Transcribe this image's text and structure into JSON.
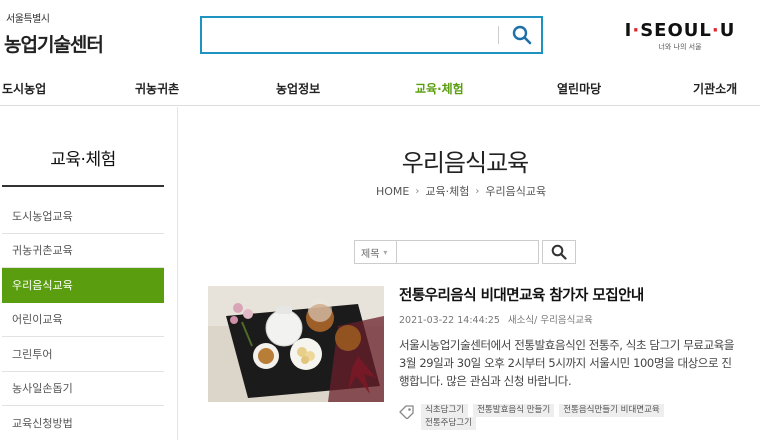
{
  "header": {
    "logo_small": "서울특별시",
    "logo_main": "농업기술센터",
    "search": {
      "value": "",
      "placeholder": ""
    },
    "seoul_brand": {
      "left": "I",
      "dot": "·",
      "middle": "SEOUL",
      "dot2": "·",
      "right": "U",
      "tagline": "너와 나의 서울"
    }
  },
  "nav": {
    "items": [
      "도시농업",
      "귀농귀촌",
      "농업정보",
      "교육·체험",
      "열린마당",
      "기관소개"
    ],
    "active_index": 3
  },
  "sidebar": {
    "title": "교육·체험",
    "items": [
      "도시농업교육",
      "귀농귀촌교육",
      "우리음식교육",
      "어린이교육",
      "그린투어",
      "농사일손돕기",
      "교육신청방법"
    ],
    "active_index": 2
  },
  "page": {
    "title": "우리음식교육",
    "breadcrumb": [
      "HOME",
      "교육·체험",
      "우리음식교육"
    ]
  },
  "filter": {
    "select_value": "제목",
    "input_value": "",
    "input_placeholder": ""
  },
  "article": {
    "title": "전통우리음식 비대면교육 참가자 모집안내",
    "date": "2021-03-22 14:44:25",
    "category": "새소식/ 우리음식교육",
    "body": "서울시농업기술센터에서 전통발효음식인 전통주, 식초 담그기 무료교육을 3월 29일과 30일 오후 2시부터 5시까지 서울시민 100명을 대상으로 진행합니다. 많은 관심과 신청 바랍니다.",
    "tags": [
      "식초담그기",
      "전통발효음식 만들기",
      "전통음식만들기 비대면교육",
      "전통주담그기"
    ]
  },
  "colors": {
    "accent_green": "#5a9e0f",
    "search_border": "#1f93bf",
    "seoul_dot": "#e0232d"
  },
  "icons": {
    "search": "search-icon",
    "filter_search": "search-icon",
    "tag": "tag-icon",
    "caret": "chevron-down-icon"
  }
}
